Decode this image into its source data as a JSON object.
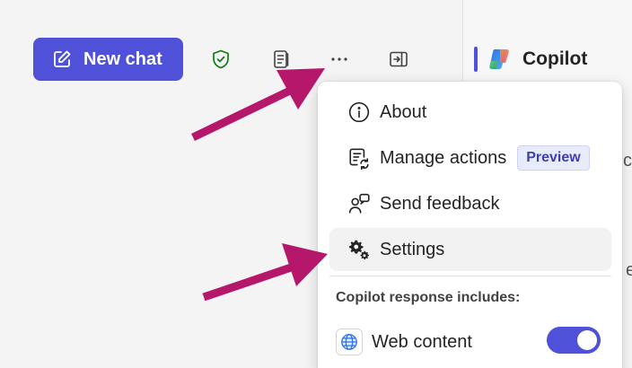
{
  "toolbar": {
    "new_chat_label": "New chat",
    "icons": [
      "compose-icon",
      "shield-check-icon",
      "notes-icon",
      "more-icon",
      "sidebar-toggle-icon"
    ],
    "more_label": "···"
  },
  "copilot": {
    "title": "Copilot",
    "peek_1": "c",
    "peek_2": "e"
  },
  "menu": {
    "items": [
      {
        "label": "About",
        "icon": "info-icon"
      },
      {
        "label": "Manage actions",
        "icon": "manage-actions-icon",
        "badge": "Preview"
      },
      {
        "label": "Send feedback",
        "icon": "feedback-icon"
      },
      {
        "label": "Settings",
        "icon": "settings-icon"
      }
    ],
    "section_label": "Copilot response includes:",
    "web_content_label": "Web content",
    "web_content_enabled": true
  },
  "colors": {
    "accent": "#4f52d9",
    "annotation_arrow": "#b5176a",
    "shield_green": "#107c10"
  }
}
